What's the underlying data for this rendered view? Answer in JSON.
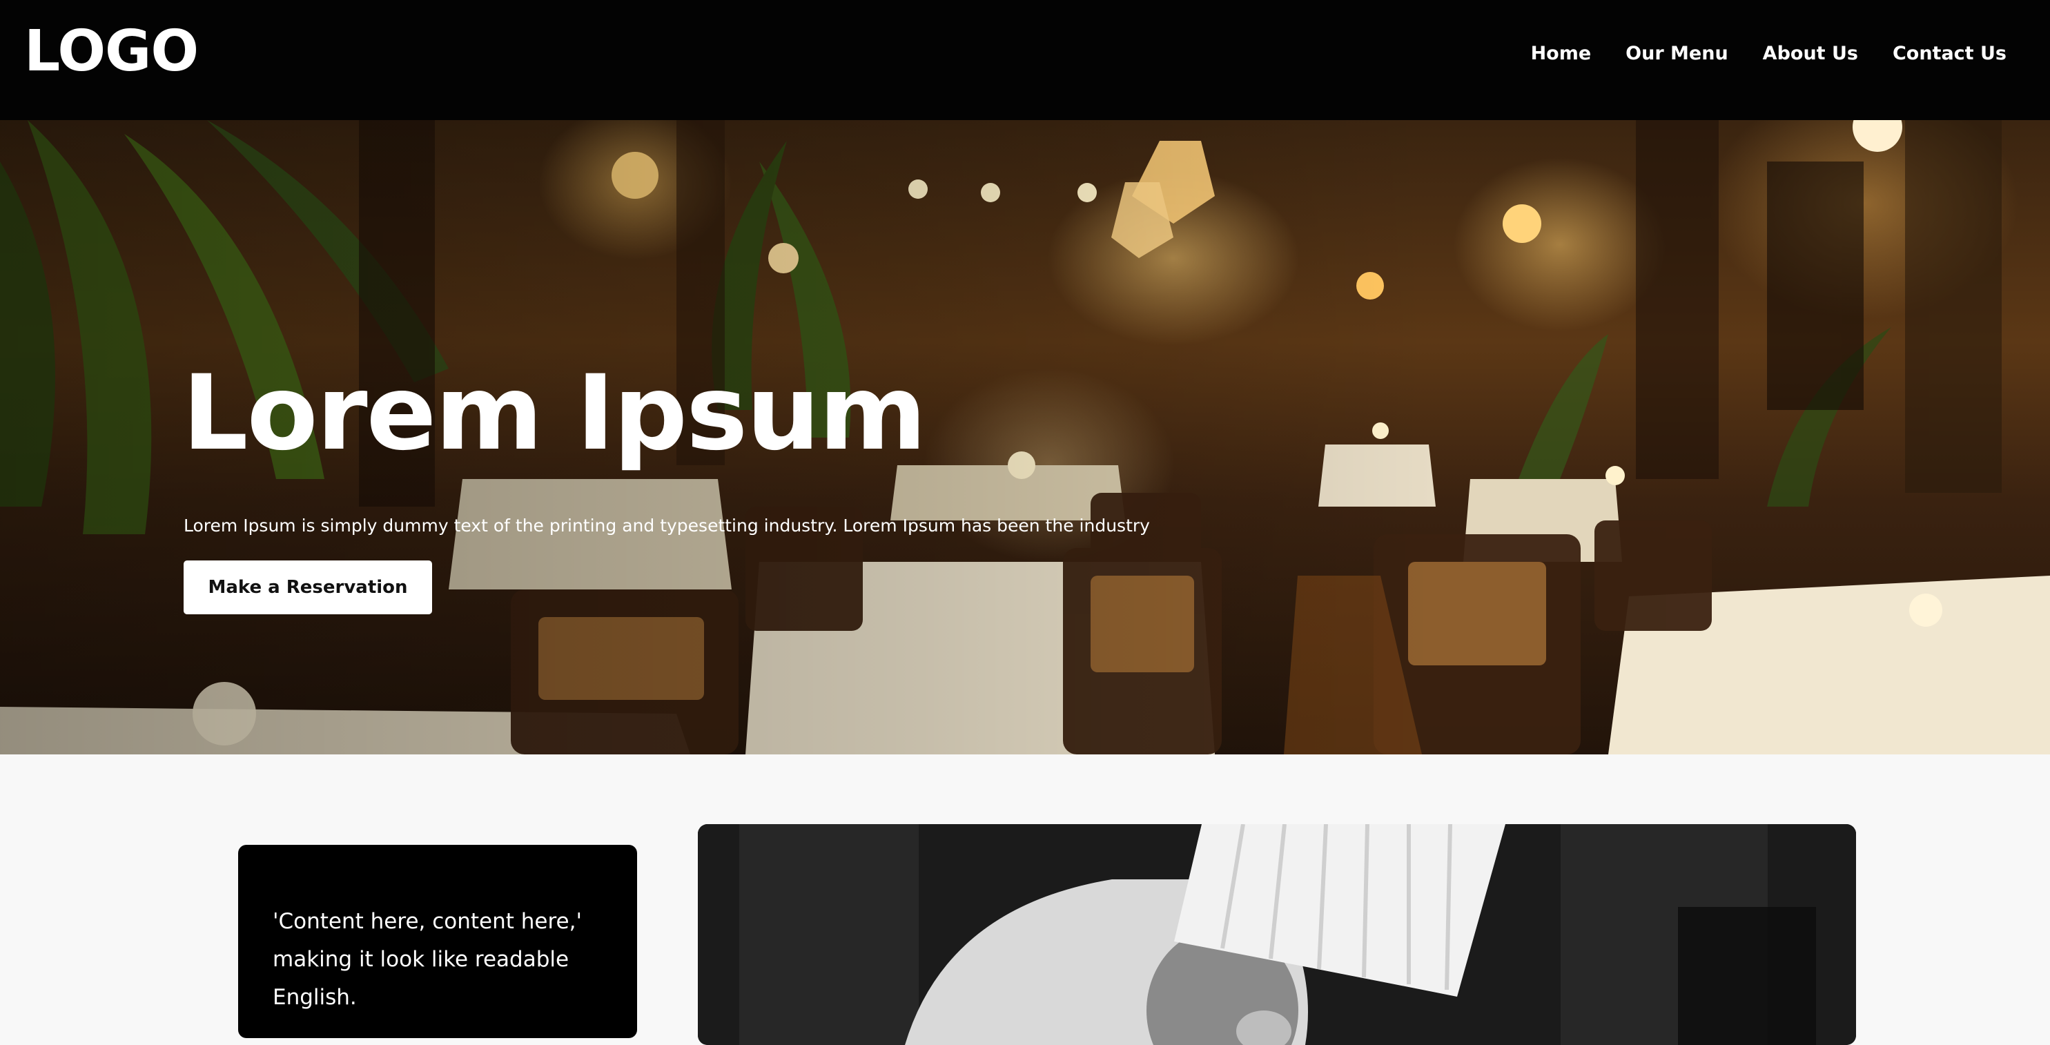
{
  "header": {
    "logo_text": "LOGO",
    "nav": [
      {
        "label": "Home"
      },
      {
        "label": "Our Menu"
      },
      {
        "label": "About Us"
      },
      {
        "label": "Contact Us"
      }
    ]
  },
  "hero": {
    "title": "Lorem Ipsum",
    "subtitle": "Lorem Ipsum is simply dummy text of the printing and typesetting industry. Lorem Ipsum has been the industry",
    "cta_label": "Make a Reservation"
  },
  "feature": {
    "quote_lines": [
      "'Content here, content here,'",
      "making it look like readable",
      "English."
    ]
  },
  "colors": {
    "nav_background": "#030303",
    "page_background": "#f8f8f8",
    "cta_background": "#ffffff",
    "quote_card_background": "#000000"
  }
}
